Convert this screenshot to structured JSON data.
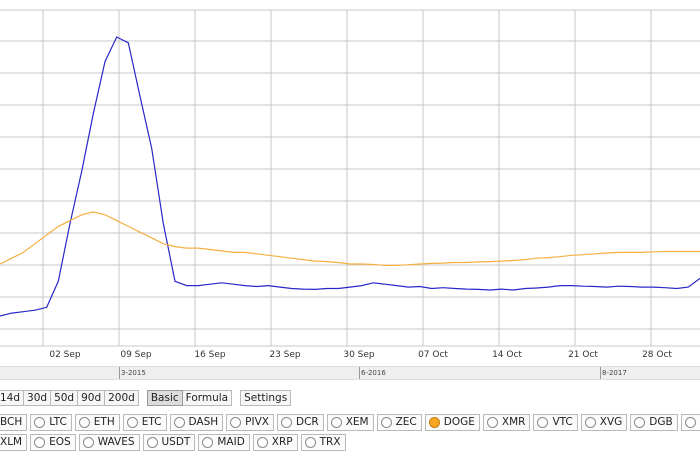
{
  "colors": {
    "series_blue": "#2828c8",
    "series_orange": "#f5b042",
    "grid": "#c8c8c8",
    "navigator_bg": "#efefef",
    "selected_radio": "#f5a623"
  },
  "chart_data": {
    "type": "line",
    "x_tick_labels": [
      "02 Sep",
      "09 Sep",
      "16 Sep",
      "23 Sep",
      "30 Sep",
      "07 Oct",
      "14 Oct",
      "21 Oct",
      "28 Oct"
    ],
    "y_range": [
      0,
      10
    ],
    "grid": true,
    "series": [
      {
        "color": "#2828c8",
        "values": [
          0.0,
          0.1,
          0.15,
          0.2,
          0.3,
          1.2,
          3.2,
          5.0,
          7.0,
          8.8,
          9.65,
          9.45,
          7.6,
          5.8,
          3.2,
          1.2,
          1.05,
          1.05,
          1.1,
          1.15,
          1.1,
          1.05,
          1.02,
          1.05,
          1.0,
          0.95,
          0.93,
          0.92,
          0.95,
          0.95,
          1.0,
          1.05,
          1.15,
          1.1,
          1.05,
          1.0,
          1.02,
          0.95,
          0.98,
          0.95,
          0.93,
          0.92,
          0.9,
          0.93,
          0.9,
          0.95,
          0.97,
          1.0,
          1.05,
          1.05,
          1.03,
          1.02,
          1.0,
          1.03,
          1.02,
          1.0,
          1.0,
          0.98,
          0.95,
          1.0,
          1.3
        ]
      },
      {
        "color": "#f5b042",
        "values": [
          1.8,
          2.0,
          2.2,
          2.5,
          2.8,
          3.1,
          3.3,
          3.5,
          3.6,
          3.5,
          3.3,
          3.1,
          2.9,
          2.7,
          2.5,
          2.4,
          2.35,
          2.35,
          2.3,
          2.25,
          2.2,
          2.2,
          2.15,
          2.1,
          2.05,
          2.0,
          1.95,
          1.9,
          1.88,
          1.85,
          1.8,
          1.8,
          1.78,
          1.75,
          1.75,
          1.77,
          1.8,
          1.82,
          1.83,
          1.85,
          1.85,
          1.87,
          1.88,
          1.9,
          1.92,
          1.95,
          2.0,
          2.02,
          2.05,
          2.1,
          2.12,
          2.15,
          2.18,
          2.2,
          2.2,
          2.2,
          2.22,
          2.23,
          2.23,
          2.23,
          2.23
        ]
      }
    ]
  },
  "navigator": {
    "labels": [
      "3-2015",
      "6-2016",
      "8-2017"
    ]
  },
  "range_buttons": [
    {
      "label": "14d"
    },
    {
      "label": "30d"
    },
    {
      "label": "50d"
    },
    {
      "label": "90d"
    },
    {
      "label": "200d"
    }
  ],
  "mode_buttons": [
    {
      "label": "Basic",
      "active": true
    },
    {
      "label": "Formula",
      "active": false
    }
  ],
  "settings_label": "Settings",
  "coins_row1": [
    {
      "label": "BCH",
      "selected": false
    },
    {
      "label": "LTC",
      "selected": false
    },
    {
      "label": "ETH",
      "selected": false
    },
    {
      "label": "ETC",
      "selected": false
    },
    {
      "label": "DASH",
      "selected": false
    },
    {
      "label": "PIVX",
      "selected": false
    },
    {
      "label": "DCR",
      "selected": false
    },
    {
      "label": "XEM",
      "selected": false
    },
    {
      "label": "ZEC",
      "selected": false
    },
    {
      "label": "DOGE",
      "selected": true
    },
    {
      "label": "XMR",
      "selected": false
    },
    {
      "label": "VTC",
      "selected": false
    },
    {
      "label": "XVG",
      "selected": false
    },
    {
      "label": "DGB",
      "selected": false
    },
    {
      "label": "",
      "selected": false
    }
  ],
  "coins_row2": [
    {
      "label": "XLM",
      "selected": false
    },
    {
      "label": "EOS",
      "selected": false
    },
    {
      "label": "WAVES",
      "selected": false
    },
    {
      "label": "USDT",
      "selected": false
    },
    {
      "label": "MAID",
      "selected": false
    },
    {
      "label": "XRP",
      "selected": false
    },
    {
      "label": "TRX",
      "selected": false
    }
  ]
}
